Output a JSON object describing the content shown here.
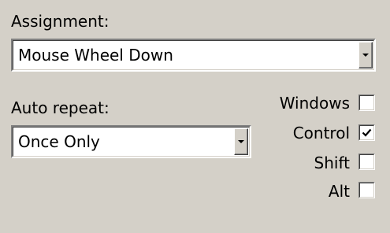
{
  "assignment": {
    "label": "Assignment:",
    "value": "Mouse Wheel Down"
  },
  "auto_repeat": {
    "label": "Auto repeat:",
    "value": "Once Only"
  },
  "modifiers": [
    {
      "label": "Windows",
      "checked": false
    },
    {
      "label": "Control",
      "checked": true
    },
    {
      "label": "Shift",
      "checked": false
    },
    {
      "label": "Alt",
      "checked": false
    }
  ]
}
